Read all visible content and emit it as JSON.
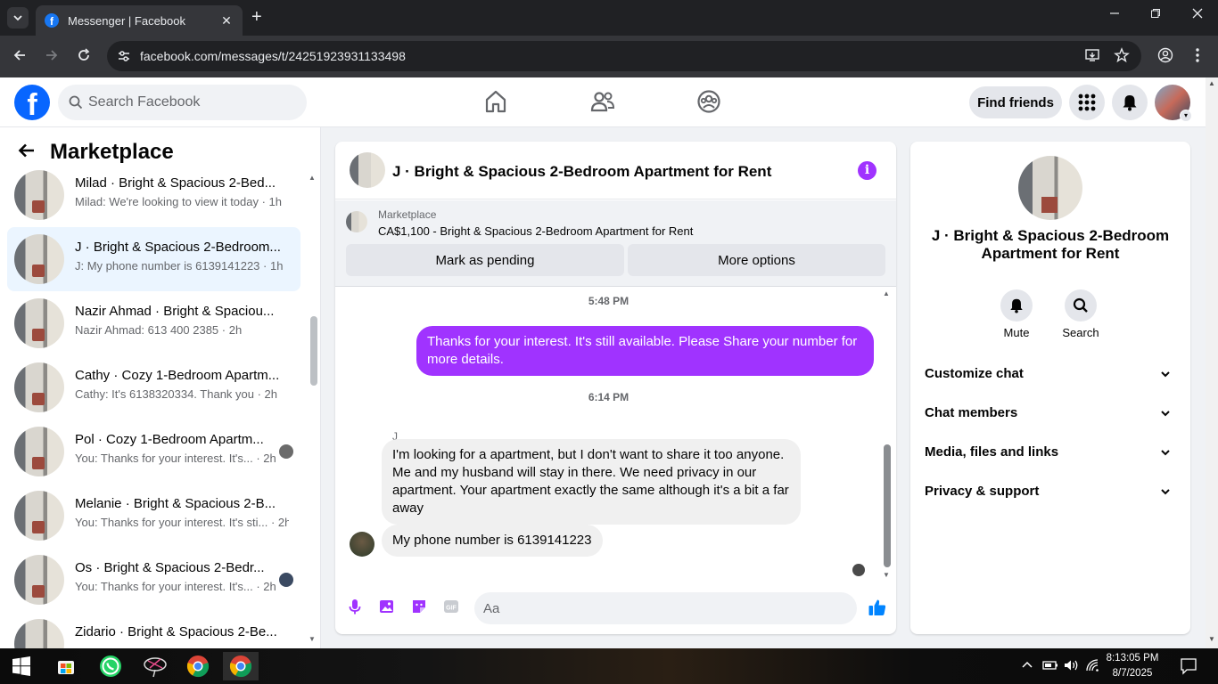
{
  "browser": {
    "tab_title": "Messenger | Facebook",
    "url": "facebook.com/messages/t/24251923931133498",
    "new_tab_glyph": "+",
    "close_glyph": "✕"
  },
  "facebook": {
    "search_placeholder": "Search Facebook",
    "find_friends": "Find friends"
  },
  "left_panel": {
    "title": "Marketplace",
    "conversations": [
      {
        "name": "Milad · Bright & Spacious 2-Bed...",
        "preview": "Milad: We're looking to view it today · 1h",
        "active": false
      },
      {
        "name": "J · Bright & Spacious 2-Bedroom...",
        "preview": "J: My phone number is 6139141223 · 1h",
        "active": true
      },
      {
        "name": "Nazir Ahmad · Bright & Spaciou...",
        "preview": "Nazir Ahmad: 613 400 2385 · 2h",
        "active": false
      },
      {
        "name": "Cathy · Cozy 1-Bedroom Apartm...",
        "preview": "Cathy: It's 6138320334. Thank you · 2h",
        "active": false
      },
      {
        "name": "Pol · Cozy 1-Bedroom Apartm...",
        "preview": "You: Thanks for your interest. It's... · 2h",
        "active": false
      },
      {
        "name": "Melanie · Bright & Spacious 2-B...",
        "preview": "You: Thanks for your interest. It's sti... · 2h",
        "active": false
      },
      {
        "name": "Os · Bright & Spacious 2-Bedr...",
        "preview": "You: Thanks for your interest. It's... · 2h",
        "active": false
      },
      {
        "name": "Zidario · Bright & Spacious 2-Be...",
        "preview": "",
        "active": false
      }
    ]
  },
  "chat": {
    "header_title": "J · Bright & Spacious 2-Bedroom Apartment for Rent",
    "info_glyph": "i",
    "marketplace_label": "Marketplace",
    "listing": "CA$1,100 - Bright & Spacious 2-Bedroom Apartment for Rent",
    "mark_pending": "Mark as pending",
    "more_options": "More options",
    "timestamp_1": "5:48 PM",
    "outgoing_1": "Thanks for your interest.  It's still available. Please Share your number for more details.",
    "timestamp_2": "6:14 PM",
    "sender_name": "J",
    "incoming_1": "I'm looking for a apartment, but I don't want to share it too anyone. Me and my husband will stay in there. We need privacy in our apartment. Your apartment exactly the same although it's a bit a far away",
    "incoming_2": "My phone number is 6139141223",
    "composer_placeholder": "Aa"
  },
  "info_panel": {
    "name": "J · Bright & Spacious 2-Bedroom Apartment for Rent",
    "mute": "Mute",
    "search": "Search",
    "sections": [
      "Customize chat",
      "Chat members",
      "Media, files and links",
      "Privacy & support"
    ]
  },
  "taskbar": {
    "time": "8:13:05 PM",
    "date": "8/7/2025"
  },
  "colors": {
    "fb_blue": "#0866ff",
    "accent_purple": "#a033ff",
    "active_row": "#ebf5ff",
    "messenger_blue": "#0084ff"
  }
}
